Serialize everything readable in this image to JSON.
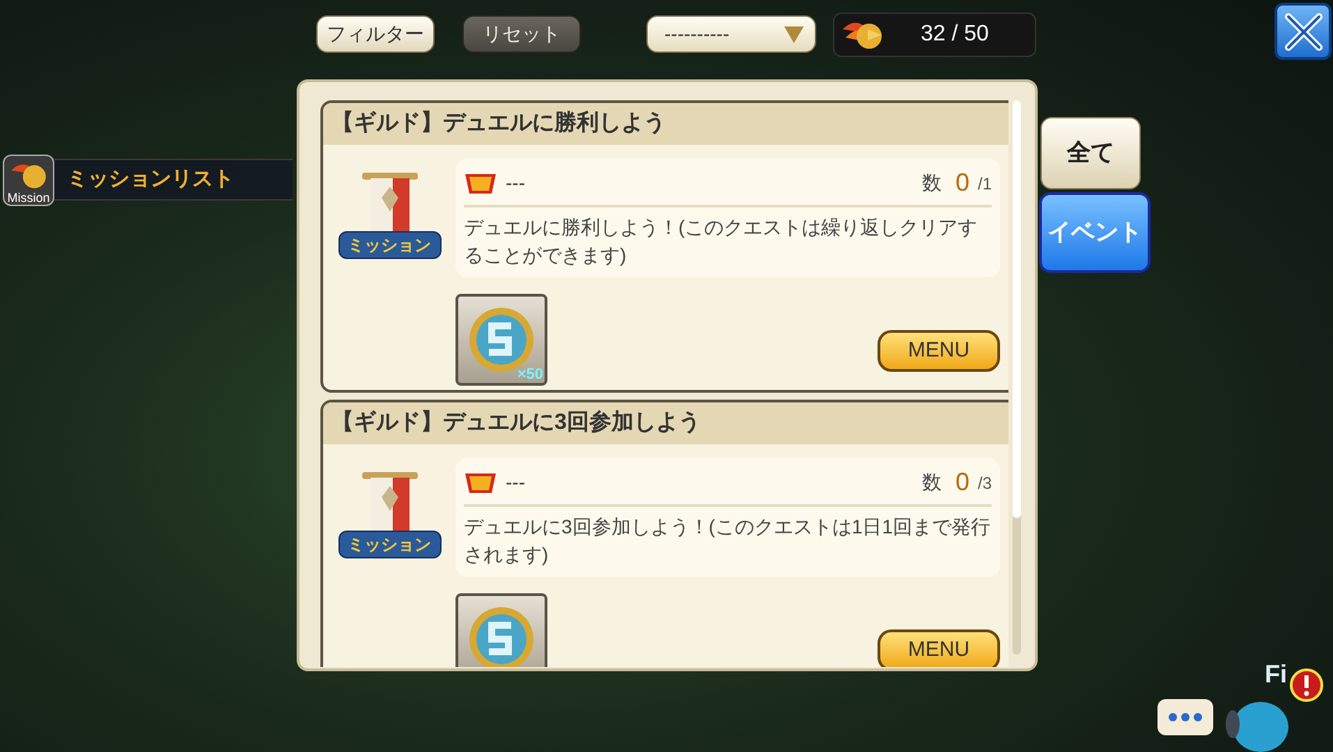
{
  "top_bar": {
    "filter_button": "フィルター",
    "reset_button": "リセット",
    "dropdown": {
      "value": "----------"
    },
    "stamina": "32 / 50"
  },
  "side_label": {
    "icon_caption": "Mission",
    "title": "ミッションリスト"
  },
  "category_tabs": [
    {
      "label": "全て",
      "selected": false
    },
    {
      "label": "イベント",
      "selected": true
    }
  ],
  "missions": [
    {
      "title": "【ギルド】デュエルに勝利しよう",
      "badge_caption": "ミッション",
      "bp": "---",
      "count_label": "数",
      "count": "0",
      "total": "/1",
      "description": "デュエルに勝利しよう！(このクエストは繰り返しクリアすることができます)",
      "reward_quantity": "×50",
      "menu_button": "MENU"
    },
    {
      "title": "【ギルド】デュエルに3回参加しよう",
      "badge_caption": "ミッション",
      "bp": "---",
      "count_label": "数",
      "count": "0",
      "total": "/3",
      "description": "デュエルに3回参加しよう！(このクエストは1日1回まで発行されます)",
      "menu_button": "MENU"
    }
  ],
  "field_caption": "Fi"
}
